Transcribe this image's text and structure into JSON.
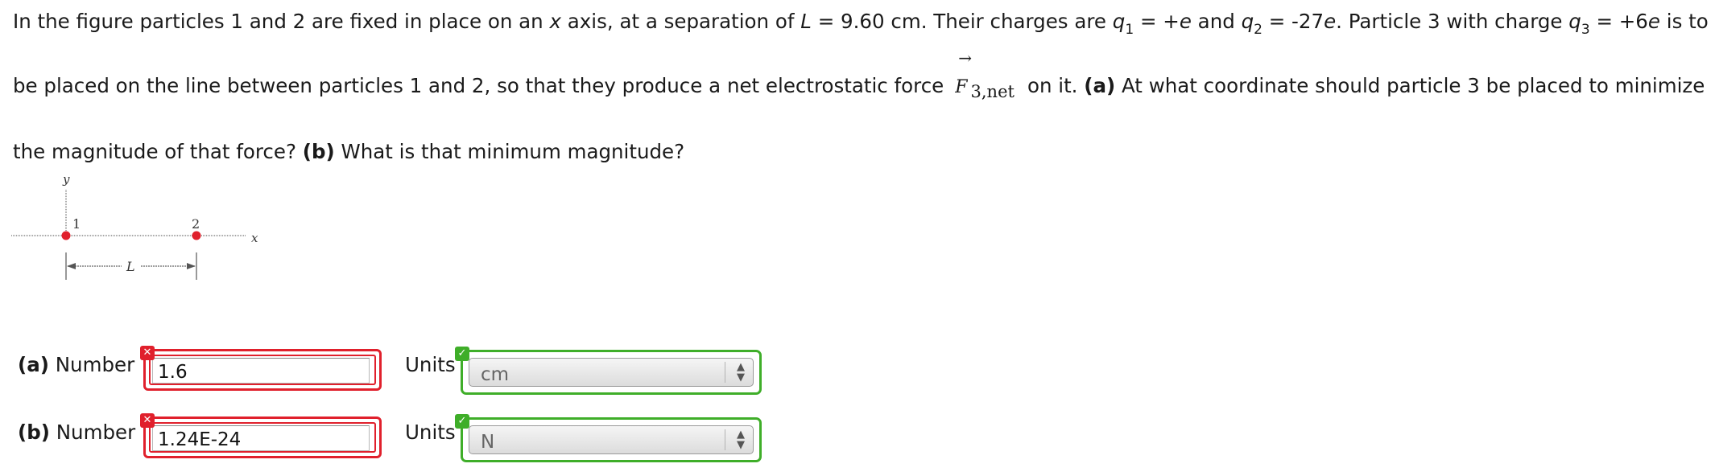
{
  "question": {
    "l1_a": "In the figure particles 1 and 2 are fixed in place on an ",
    "l1_x": "x",
    "l1_b": " axis, at a separation of ",
    "l1_L": "L",
    "l1_c": " = 9.60 cm. Their charges are ",
    "l1_q": "q",
    "l1_q1sub": "1",
    "l1_d": " = +",
    "l1_e1": "e",
    "l1_f": " and ",
    "l1_q2": "q",
    "l1_q2sub": "2",
    "l1_g": " = -27",
    "l1_e2": "e",
    "l1_h": ". Particle 3 with charge ",
    "l1_q3": "q",
    "l1_q3sub": "3",
    "l1_i": " = +6",
    "l1_e3": "e",
    "l1_j": " is to",
    "l2_a": "be placed on the line between particles 1 and 2, so that they produce a net electrostatic force",
    "force_symbol": "F",
    "force_arrow": "→",
    "force_sub": "3,net",
    "l2_b": "on it. ",
    "l2_part_a": "(a)",
    "l2_c": " At what coordinate should particle 3 be placed to minimize",
    "l3_a": "the magnitude of that force? ",
    "l3_part_b": "(b)",
    "l3_b": " What is that minimum magnitude?"
  },
  "figure": {
    "y_label": "y",
    "x_label": "x",
    "p1_label": "1",
    "p2_label": "2",
    "L_label": "L",
    "particle_color": "#e0202c"
  },
  "answers": {
    "a": {
      "label_bold": "(a)",
      "label_text": " Number",
      "number_value": "1.6",
      "number_status": "incorrect",
      "units_label": "Units",
      "units_value": "cm",
      "units_status": "correct"
    },
    "b": {
      "label_bold": "(b)",
      "label_text": " Number",
      "number_value": "1.24E-24",
      "number_status": "incorrect",
      "units_label": "Units",
      "units_value": "N",
      "units_status": "correct"
    }
  },
  "colors": {
    "incorrect": "#e0202c",
    "correct": "#3fae29"
  }
}
